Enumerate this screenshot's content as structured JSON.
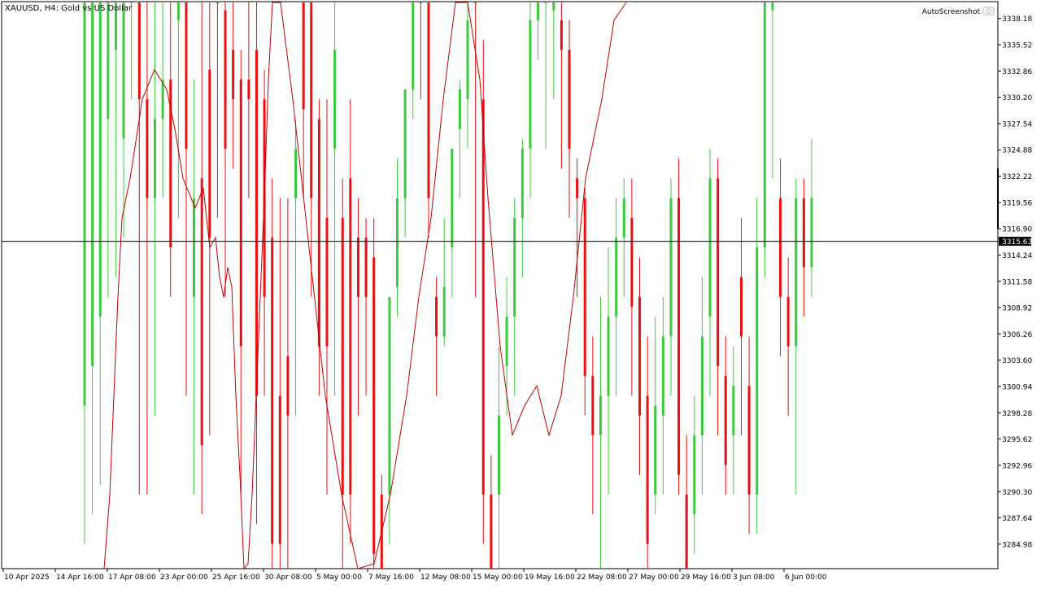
{
  "chart_data": {
    "type": "candlestick",
    "symbol": "XAUUSD",
    "timeframe": "H4",
    "title": "XAUUSD, H4:  Gold vs US Dollar",
    "watermark": "AutoScreenshot",
    "current_price": 3315.63,
    "current_price_label": "3315.63",
    "ylim": [
      3282.5,
      3339.8
    ],
    "y_ticks": [
      "3338.18",
      "3335.52",
      "3332.86",
      "3330.20",
      "3327.54",
      "3324.88",
      "3322.22",
      "3319.56",
      "3316.90",
      "3314.24",
      "3311.58",
      "3308.92",
      "3306.26",
      "3303.60",
      "3300.94",
      "3298.28",
      "3295.62",
      "3292.96",
      "3290.30",
      "3287.64",
      "3284.98"
    ],
    "x_ticks": [
      "10 Apr 2025",
      "14 Apr 16:00",
      "17 Apr 08:00",
      "23 Apr 00:00",
      "25 Apr 16:00",
      "30 Apr 08:00",
      "5 May 00:00",
      "7 May 16:00",
      "12 May 08:00",
      "15 May 00:00",
      "19 May 16:00",
      "22 May 08:00",
      "27 May 00:00",
      "29 May 16:00",
      "3 Jun 08:00",
      "6 Jun 00:00"
    ],
    "colors": {
      "bull": "#3cc83c",
      "bear": "#e81010",
      "ma": "#c00000",
      "grid_text": "#000000",
      "price_line": "#000000",
      "price_box": "#000000"
    },
    "candles": [
      [
        3299,
        3341,
        3285,
        3342
      ],
      [
        3303,
        3341,
        3288,
        3342
      ],
      [
        3308,
        3341,
        3291,
        3342
      ],
      [
        3328,
        3342,
        3310,
        3343
      ],
      [
        3335,
        3341,
        3312,
        3343
      ],
      [
        3326,
        3341,
        3316,
        3343
      ],
      [
        3340,
        3341,
        3330,
        3343
      ],
      [
        3341,
        3330,
        3290,
        3343
      ],
      [
        3330,
        3320,
        3290,
        3343
      ],
      [
        3320,
        3328,
        3298,
        3342
      ],
      [
        3328,
        3332,
        3320,
        3342
      ],
      [
        3332,
        3315,
        3310,
        3342
      ],
      [
        3338,
        3342,
        3318,
        3343
      ],
      [
        3342,
        3325,
        3300,
        3343
      ],
      [
        3310,
        3320,
        3290,
        3332
      ],
      [
        3322,
        3295,
        3288,
        3340
      ],
      [
        3333,
        3316,
        3296,
        3342
      ],
      [
        3345,
        3340,
        3318,
        3346
      ],
      [
        3339,
        3325,
        3310,
        3342
      ],
      [
        3335,
        3330,
        3323,
        3340
      ],
      [
        3332,
        3305,
        3290,
        3335
      ],
      [
        3332,
        3330,
        3320,
        3342
      ],
      [
        3335,
        3300,
        3287,
        3340
      ],
      [
        3330,
        3310,
        3300,
        3333
      ],
      [
        3316,
        3285,
        3280,
        3322
      ],
      [
        3300,
        3285,
        3280,
        3320
      ],
      [
        3304,
        3298,
        3280,
        3320
      ],
      [
        3320,
        3325,
        3298,
        3328
      ],
      [
        3342,
        3329,
        3320,
        3344
      ],
      [
        3340,
        3320,
        3310,
        3342
      ],
      [
        3328,
        3305,
        3300,
        3330
      ],
      [
        3318,
        3305,
        3290,
        3330
      ],
      [
        3325,
        3335,
        3300,
        3340
      ],
      [
        3318,
        3290,
        3280,
        3322
      ],
      [
        3322,
        3290,
        3285,
        3330
      ],
      [
        3316,
        3310,
        3298,
        3320
      ],
      [
        3316,
        3310,
        3300,
        3318
      ],
      [
        3314,
        3284,
        3280,
        3318
      ],
      [
        3290,
        3280,
        3278,
        3292
      ],
      [
        3290,
        3310,
        3285,
        3295
      ],
      [
        3311,
        3320,
        3308,
        3324
      ],
      [
        3320,
        3331,
        3316,
        3328
      ],
      [
        3331,
        3341,
        3328,
        3342
      ],
      [
        3342,
        3341,
        3330,
        3343
      ],
      [
        3342,
        3320,
        3316,
        3343
      ],
      [
        3310,
        3306,
        3300,
        3312
      ],
      [
        3306,
        3311,
        3305,
        3318
      ],
      [
        3315,
        3325,
        3310,
        3322
      ],
      [
        3327,
        3331,
        3320,
        3332
      ],
      [
        3330,
        3338,
        3325,
        3340
      ],
      [
        3341,
        3340,
        3310,
        3342
      ],
      [
        3330,
        3290,
        3285,
        3336
      ],
      [
        3290,
        3280,
        3278,
        3294
      ],
      [
        3290,
        3298,
        3280,
        3305
      ],
      [
        3303,
        3308,
        3298,
        3312
      ],
      [
        3308,
        3318,
        3300,
        3320
      ],
      [
        3318,
        3325,
        3312,
        3326
      ],
      [
        3325,
        3338,
        3320,
        3340
      ],
      [
        3338,
        3342,
        3334,
        3343
      ],
      [
        3340,
        3341,
        3325,
        3342
      ],
      [
        3339,
        3342,
        3330,
        3343
      ],
      [
        3338,
        3335,
        3323,
        3341
      ],
      [
        3335,
        3325,
        3318,
        3338
      ],
      [
        3322,
        3320,
        3310,
        3324
      ],
      [
        3320,
        3302,
        3298,
        3321
      ],
      [
        3302,
        3296,
        3288,
        3306
      ],
      [
        3296,
        3300,
        3280,
        3310
      ],
      [
        3300,
        3308,
        3290,
        3315
      ],
      [
        3308,
        3316,
        3300,
        3320
      ],
      [
        3316,
        3320,
        3310,
        3322
      ],
      [
        3318,
        3309,
        3300,
        3322
      ],
      [
        3310,
        3298,
        3292,
        3314
      ],
      [
        3300,
        3285,
        3280,
        3306
      ],
      [
        3290,
        3299,
        3288,
        3308
      ],
      [
        3298,
        3306,
        3290,
        3310
      ],
      [
        3306,
        3320,
        3300,
        3322
      ],
      [
        3320,
        3292,
        3290,
        3324
      ],
      [
        3290,
        3282,
        3280,
        3296
      ],
      [
        3288,
        3296,
        3284,
        3300
      ],
      [
        3296,
        3306,
        3290,
        3312
      ],
      [
        3308,
        3322,
        3300,
        3325
      ],
      [
        3322,
        3303,
        3296,
        3324
      ],
      [
        3302,
        3293,
        3290,
        3306
      ],
      [
        3296,
        3301,
        3290,
        3305
      ],
      [
        3312,
        3306,
        3296,
        3318
      ],
      [
        3301,
        3290,
        3286,
        3306
      ],
      [
        3290,
        3315,
        3286,
        3320
      ],
      [
        3315,
        3340,
        3312,
        3342
      ],
      [
        3339,
        3341,
        3322,
        3342
      ],
      [
        3320,
        3310,
        3304,
        3324
      ],
      [
        3310,
        3305,
        3298,
        3314
      ],
      [
        3305,
        3320,
        3290,
        3322
      ],
      [
        3320,
        3313,
        3308,
        3322
      ],
      [
        3313,
        3320,
        3310,
        3326
      ]
    ],
    "ma": [
      3282,
      3290,
      3300,
      3310,
      3318,
      3322,
      3330,
      3333,
      3331,
      3327,
      3322,
      3319,
      3321,
      3315,
      3316,
      3312,
      3310,
      3313,
      3311,
      3300,
      3292,
      3282,
      3283,
      3290,
      3300,
      3310,
      3320,
      3332,
      3341,
      3342,
      3330,
      3315,
      3300,
      3290,
      3282,
      3283,
      3290,
      3300,
      3310,
      3318,
      3330,
      3341,
      3341,
      3332,
      3320,
      3305,
      3296,
      3299,
      3301,
      3296,
      3300,
      3310,
      3322,
      3330,
      3338,
      3341
    ],
    "ma_x": [
      128,
      135,
      140,
      145,
      150,
      160,
      175,
      190,
      205,
      215,
      225,
      240,
      250,
      258,
      265,
      270,
      275,
      280,
      285,
      290,
      295,
      300,
      305,
      310,
      315,
      320,
      325,
      330,
      335,
      345,
      360,
      380,
      400,
      420,
      440,
      460,
      480,
      500,
      515,
      530,
      545,
      560,
      575,
      590,
      600,
      615,
      630,
      645,
      660,
      675,
      690,
      705,
      720,
      740,
      755,
      770
    ]
  }
}
